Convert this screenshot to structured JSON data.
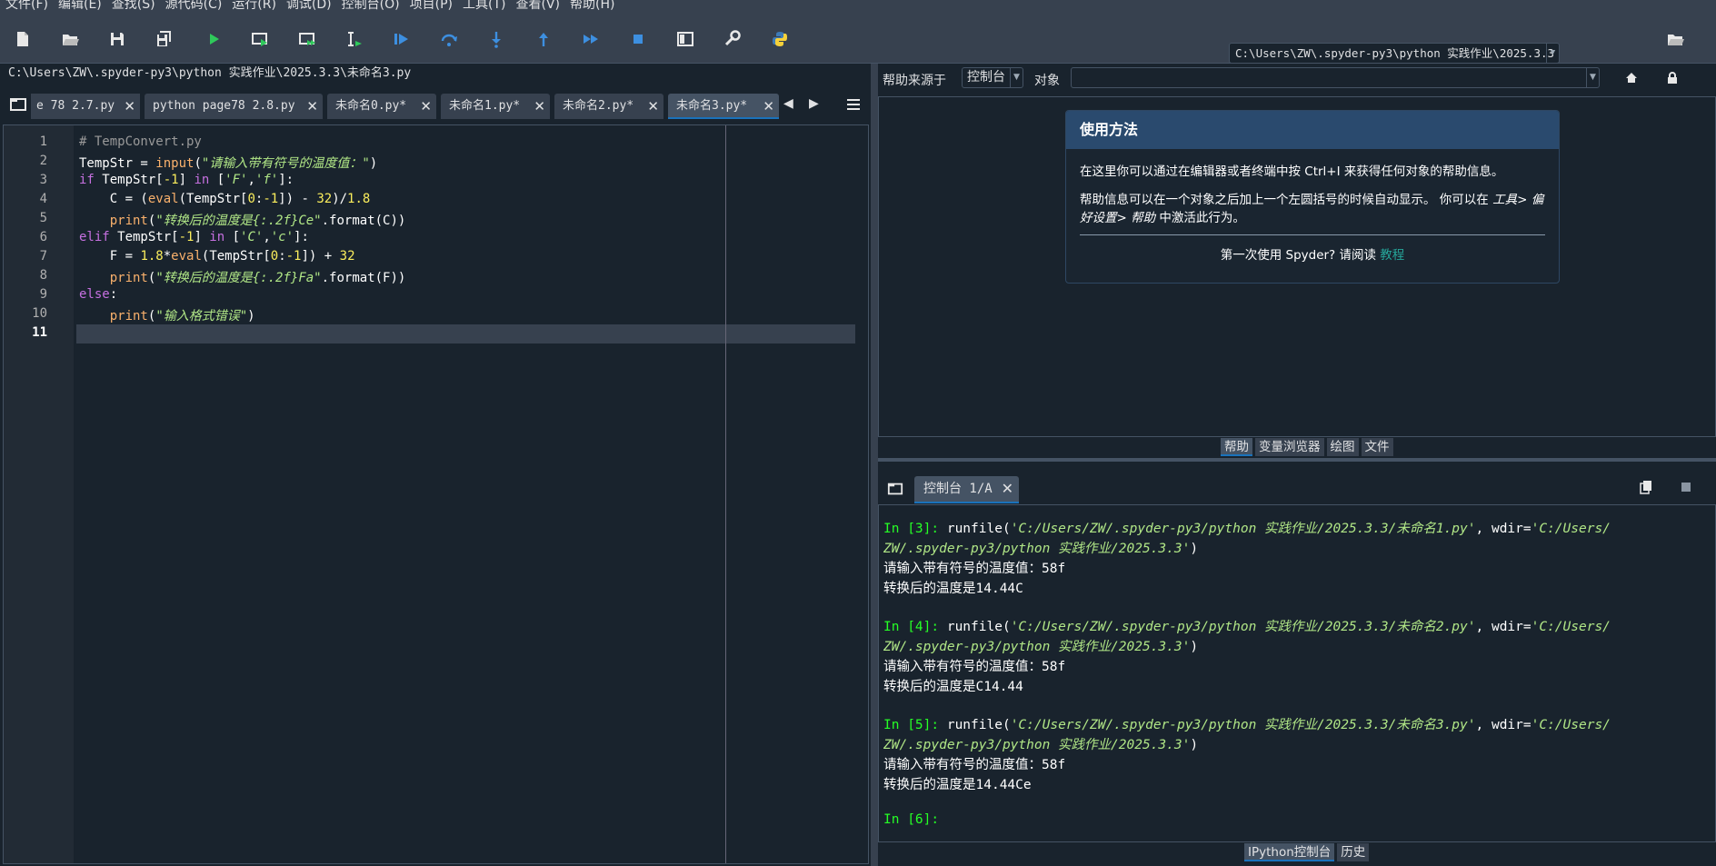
{
  "menu": [
    "文件(F)",
    "编辑(E)",
    "查找(S)",
    "源代码(C)",
    "运行(R)",
    "调试(D)",
    "控制台(O)",
    "项目(P)",
    "工具(T)",
    "查看(V)",
    "帮助(H)"
  ],
  "icons": {
    "new_file": "new-file-icon",
    "open_file": "open-file-icon",
    "save": "save-icon",
    "save_all": "save-all-icon",
    "run": "run-icon",
    "run_cell": "run-cell-icon",
    "run_cell_advance": "run-cell-advance-icon",
    "run_selection": "run-selection-icon",
    "debug": "debug-icon",
    "step_over": "step-over-icon",
    "step_into": "step-into-icon",
    "step_return": "step-return-icon",
    "continue": "continue-icon",
    "stop": "stop-icon",
    "maximize": "maximize-pane-icon",
    "preferences": "wrench-icon",
    "python_path": "python-icon",
    "browse": "folder-icon",
    "home": "home-icon",
    "lock": "lock-icon",
    "options": "hamburger-icon",
    "browse_tabs": "browse-tabs-icon"
  },
  "colors": {
    "accent": "#1a72bb",
    "keyword": "#c670e0",
    "builtin": "#fab16c",
    "string": "#b0e686",
    "number": "#faed5c",
    "prompt": "#26ff26",
    "link": "#26a69a"
  },
  "toolbar": {
    "working_dir": "C:\\Users\\ZW\\.spyder-py3\\python 实践作业\\2025.3.3"
  },
  "editor": {
    "file_path": "C:\\Users\\ZW\\.spyder-py3\\python 实践作业\\2025.3.3\\未命名3.py",
    "tabs": [
      {
        "label": "e 78 2.7.py",
        "active": false
      },
      {
        "label": "python page78 2.8.py",
        "active": false
      },
      {
        "label": "未命名0.py*",
        "active": false
      },
      {
        "label": "未命名1.py*",
        "active": false
      },
      {
        "label": "未命名2.py*",
        "active": false
      },
      {
        "label": "未命名3.py*",
        "active": true
      }
    ],
    "tab_close": "✕",
    "current_line": "11",
    "line_numbers": [
      "1",
      "2",
      "3",
      "4",
      "5",
      "6",
      "7",
      "8",
      "9",
      "10",
      "11"
    ],
    "code": {
      "l1_comment": "# TempConvert.py",
      "l2_var": "TempStr = ",
      "l2_fn": "input",
      "l2_open": "(",
      "l2_str": "\"请输入带有符号的温度值：\"",
      "l2_close": ")",
      "l3_kw": "if",
      "l3_a": " TempStr[",
      "l3_num": "-1",
      "l3_b": "] ",
      "l3_in": "in",
      "l3_c": " [",
      "l3_s1": "'F'",
      "l3_comma": ",",
      "l3_s2": "'f'",
      "l3_d": "]:",
      "l4_a": "    C = (",
      "l4_fn": "eval",
      "l4_b": "(TempStr[",
      "l4_n0": "0",
      "l4_c": ":",
      "l4_n1": "-1",
      "l4_d": "]) - ",
      "l4_n32": "32",
      "l4_e": ")/",
      "l4_n18": "1.8",
      "l5_a": "    ",
      "l5_fn": "print",
      "l5_b": "(",
      "l5_str": "\"转换后的温度是{:.2f}Ce\"",
      "l5_c": ".format(C))",
      "l6_kw": "elif",
      "l6_a": " TempStr[",
      "l6_num": "-1",
      "l6_b": "] ",
      "l6_in": "in",
      "l6_c": " [",
      "l6_s1": "'C'",
      "l6_comma": ",",
      "l6_s2": "'c'",
      "l6_d": "]:",
      "l7_a": "    F = ",
      "l7_n18": "1.8",
      "l7_op": "*",
      "l7_fn": "eval",
      "l7_b": "(TempStr[",
      "l7_n0": "0",
      "l7_c": ":",
      "l7_n1": "-1",
      "l7_d": "]) + ",
      "l7_n32": "32",
      "l8_a": "    ",
      "l8_fn": "print",
      "l8_b": "(",
      "l8_str": "\"转换后的温度是{:.2f}Fa\"",
      "l8_c": ".format(F))",
      "l9_kw": "else",
      "l9_a": ":",
      "l10_a": "    ",
      "l10_fn": "print",
      "l10_b": "(",
      "l10_str": "\"输入格式错误\"",
      "l10_c": ")"
    }
  },
  "help": {
    "source_label": "帮助来源于",
    "source_value": "控制台",
    "object_label": "对象",
    "object_value": "",
    "card_title": "使用方法",
    "para1": "在这里你可以通过在编辑器或者终端中按 Ctrl+I 来获得任何对象的帮助信息。",
    "para2_a": "帮助信息可以在一个对象之后加上一个左圆括号的时候自动显示。 你可以在 ",
    "para2_path": "工具> 偏好设置> 帮助",
    "para2_b": " 中激活此行为。",
    "footer_text": "第一次使用 Spyder? 请阅读 ",
    "footer_link": "教程",
    "tabs": [
      {
        "label": "帮助",
        "active": true
      },
      {
        "label": "变量浏览器",
        "active": false
      },
      {
        "label": "绘图",
        "active": false
      },
      {
        "label": "文件",
        "active": false
      }
    ]
  },
  "console": {
    "tab_label": "控制台 1/A",
    "tab_close": "✕",
    "blocks": [
      {
        "prompt": "In [3]:",
        "cmd": " runfile(",
        "path": "'C:/Users/ZW/.spyder-py3/python 实践作业/2025.3.3/未命名1.py'",
        "mid": ", wdir=",
        "wdir1": "'C:/Users/",
        "wdir2": "ZW/.spyder-py3/python 实践作业/2025.3.3'",
        "end": ")",
        "out1": "请输入带有符号的温度值：58f",
        "out2": "转换后的温度是14.44C"
      },
      {
        "prompt": "In [4]:",
        "cmd": " runfile(",
        "path": "'C:/Users/ZW/.spyder-py3/python 实践作业/2025.3.3/未命名2.py'",
        "mid": ", wdir=",
        "wdir1": "'C:/Users/",
        "wdir2": "ZW/.spyder-py3/python 实践作业/2025.3.3'",
        "end": ")",
        "out1": "请输入带有符号的温度值：58f",
        "out2": "转换后的温度是C14.44"
      },
      {
        "prompt": "In [5]:",
        "cmd": " runfile(",
        "path": "'C:/Users/ZW/.spyder-py3/python 实践作业/2025.3.3/未命名3.py'",
        "mid": ", wdir=",
        "wdir1": "'C:/Users/",
        "wdir2": "ZW/.spyder-py3/python 实践作业/2025.3.3'",
        "end": ")",
        "out1": "请输入带有符号的温度值：58f",
        "out2": "转换后的温度是14.44Ce"
      }
    ],
    "last_prompt": "In [6]:",
    "tabs": [
      {
        "label": "IPython控制台",
        "active": true
      },
      {
        "label": "历史",
        "active": false
      }
    ]
  }
}
